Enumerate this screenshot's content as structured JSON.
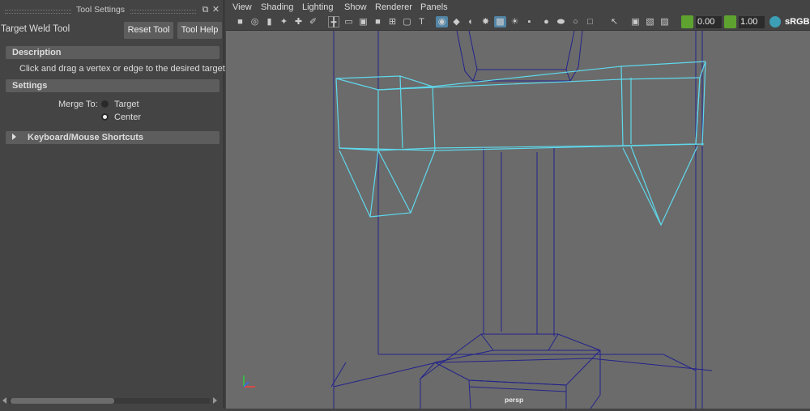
{
  "tool_settings": {
    "title": "Tool Settings",
    "tool_name": "Target Weld Tool",
    "reset_label": "Reset Tool",
    "help_label": "Tool Help",
    "sections": {
      "description": "Description",
      "settings": "Settings",
      "shortcuts": "Keyboard/Mouse Shortcuts"
    },
    "description_text": "Click and drag a vertex or edge to the desired target",
    "merge_to_label": "Merge To:",
    "merge_options": [
      "Target",
      "Center"
    ],
    "merge_selected": "Center"
  },
  "viewport": {
    "menus": [
      "View",
      "Shading",
      "Lighting",
      "Show",
      "Renderer",
      "Panels"
    ],
    "exposure": "0.00",
    "gamma": "1.00",
    "color_space": "sRGB",
    "camera_label": "persp"
  },
  "colors": {
    "selected_wire": "#5fd8ec",
    "unselected_wire": "#23238c",
    "viewport_bg": "#6b6b6b",
    "active_icon": "#5285a6",
    "exposure_icon": "#5ea32f"
  }
}
